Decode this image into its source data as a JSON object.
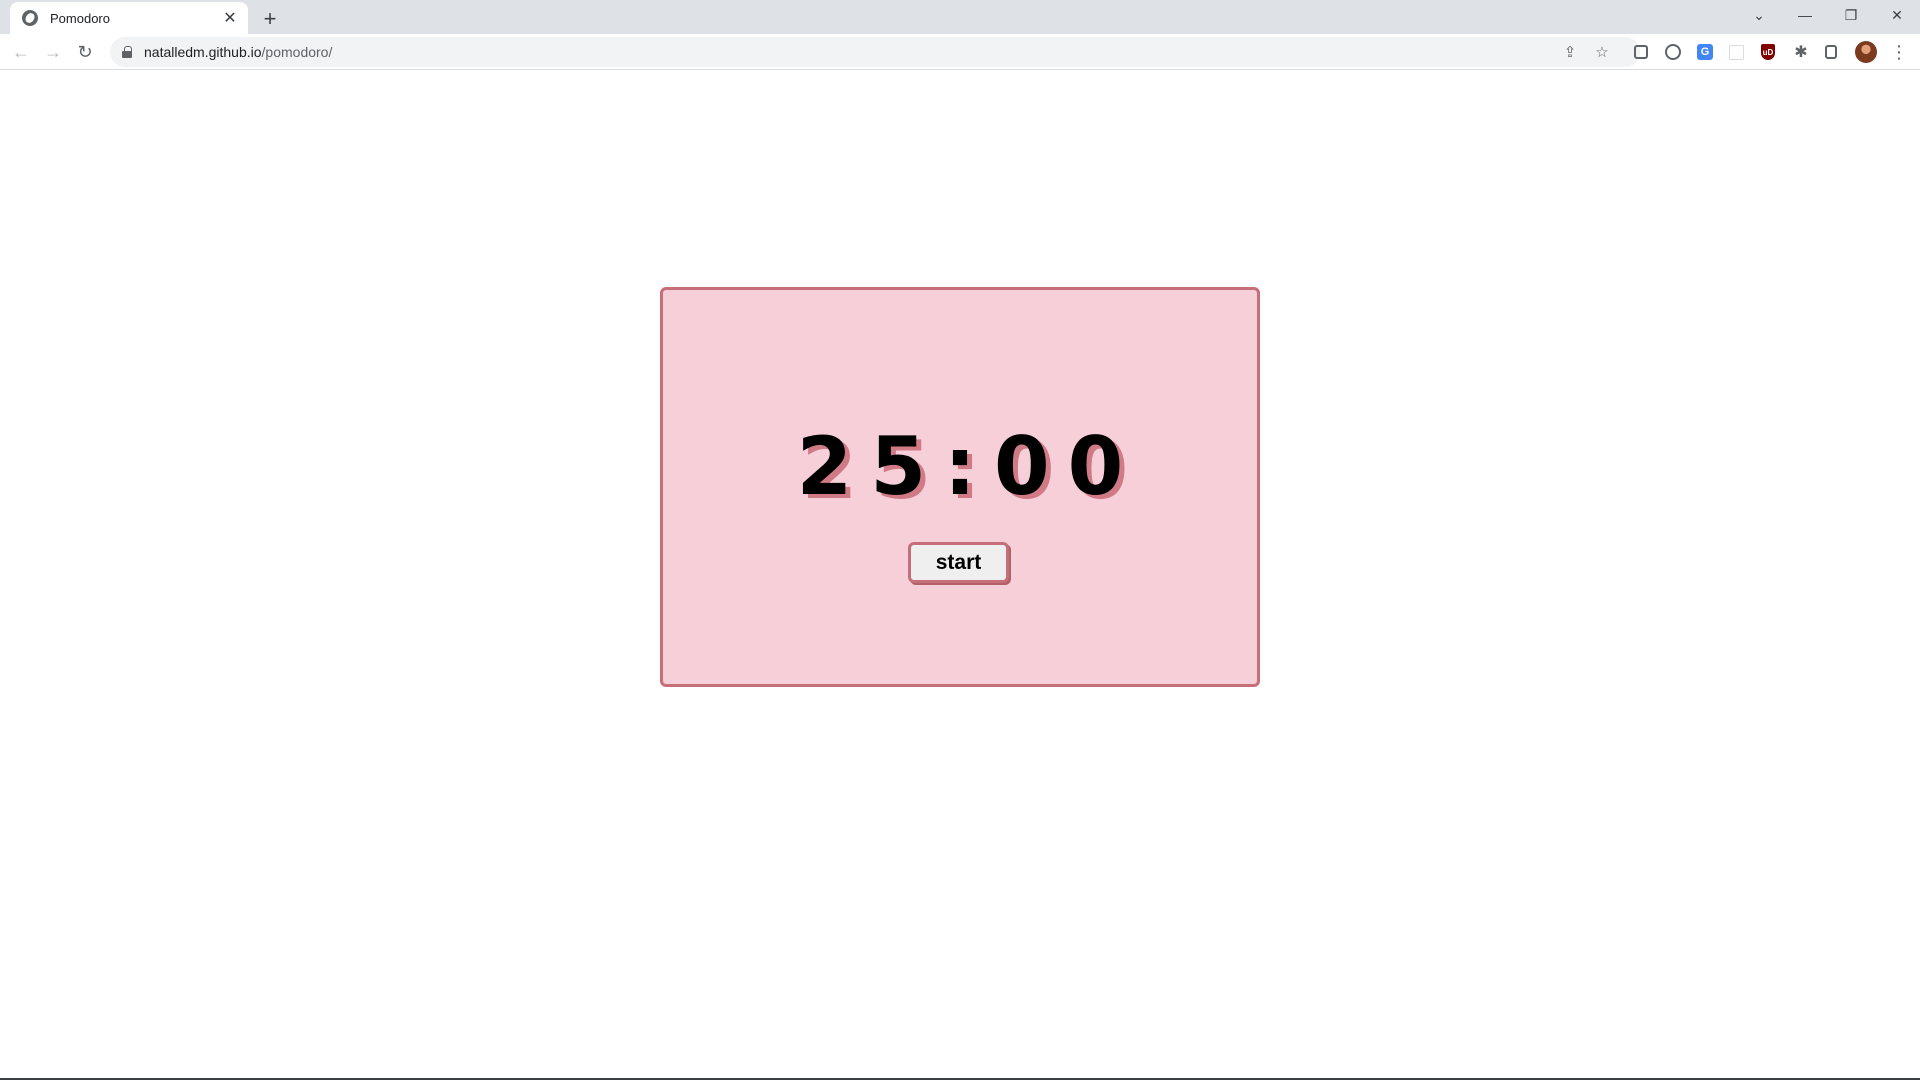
{
  "browser": {
    "tab": {
      "title": "Pomodoro",
      "close_glyph": "✕",
      "favicon": "globe-icon"
    },
    "new_tab_glyph": "+",
    "window_controls": {
      "tab_search": "⌄",
      "minimize": "—",
      "restore": "❐",
      "close": "✕"
    },
    "nav": {
      "back": "←",
      "forward": "→",
      "reload": "↻"
    },
    "url": {
      "host": "natalledm.github.io",
      "path": "/pomodoro/"
    },
    "omnibox_icons": {
      "share": "⇪",
      "bookmark": "☆"
    },
    "extensions": {
      "translate_label": "G",
      "shield_label": "uD",
      "puzzle": "✱",
      "menu": "⋮"
    }
  },
  "pomodoro": {
    "timer": "25:00",
    "start_label": "start"
  },
  "colors": {
    "card_background": "#f7cfd8",
    "card_border": "#c76f78",
    "timer_shadow": "#d07a86",
    "button_background": "#efefef"
  }
}
